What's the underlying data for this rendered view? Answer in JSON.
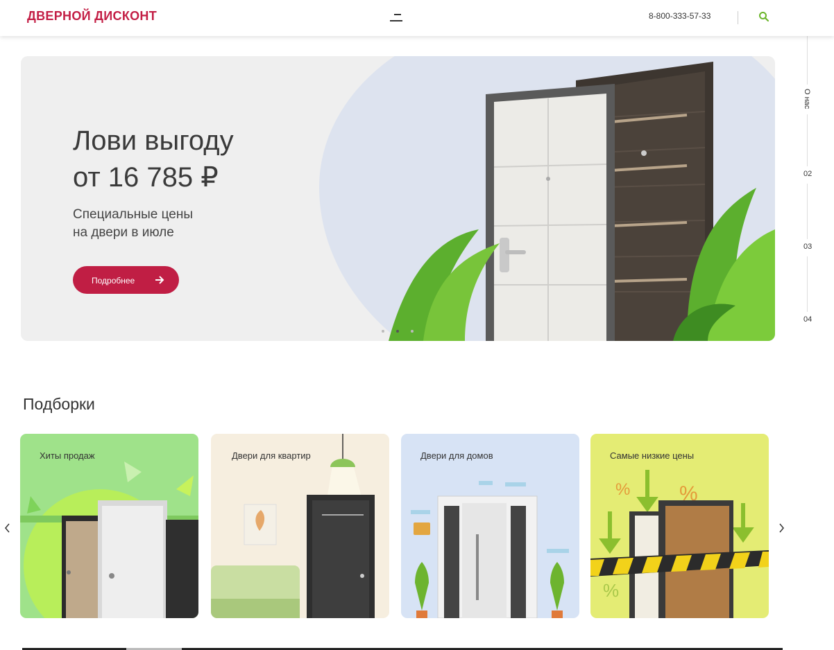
{
  "header": {
    "logo": "ДВЕРНОЙ ДИСКОНТ",
    "phone": "8-800-333-57-33"
  },
  "side_nav": {
    "about": "О нас",
    "items": [
      "02",
      "03",
      "04"
    ]
  },
  "hero": {
    "title_line1": "Лови выгоду",
    "title_line2": "от 16 785 ₽",
    "subtitle_line1": "Специальные цены",
    "subtitle_line2": "на двери в июле",
    "button_label": "Подробнее",
    "slides_count": 3,
    "active_slide": 2
  },
  "collections": {
    "title": "Подборки",
    "cards": [
      {
        "label": "Хиты продаж",
        "bg": "#9fe28a"
      },
      {
        "label": "Двери для квартир",
        "bg": "#f6eedf"
      },
      {
        "label": "Двери для домов",
        "bg": "#d7e3f5"
      },
      {
        "label": "Самые низкие цены",
        "bg": "#e4ec74"
      }
    ]
  },
  "colors": {
    "accent": "#c01e44",
    "search_icon": "#6bb52a"
  }
}
